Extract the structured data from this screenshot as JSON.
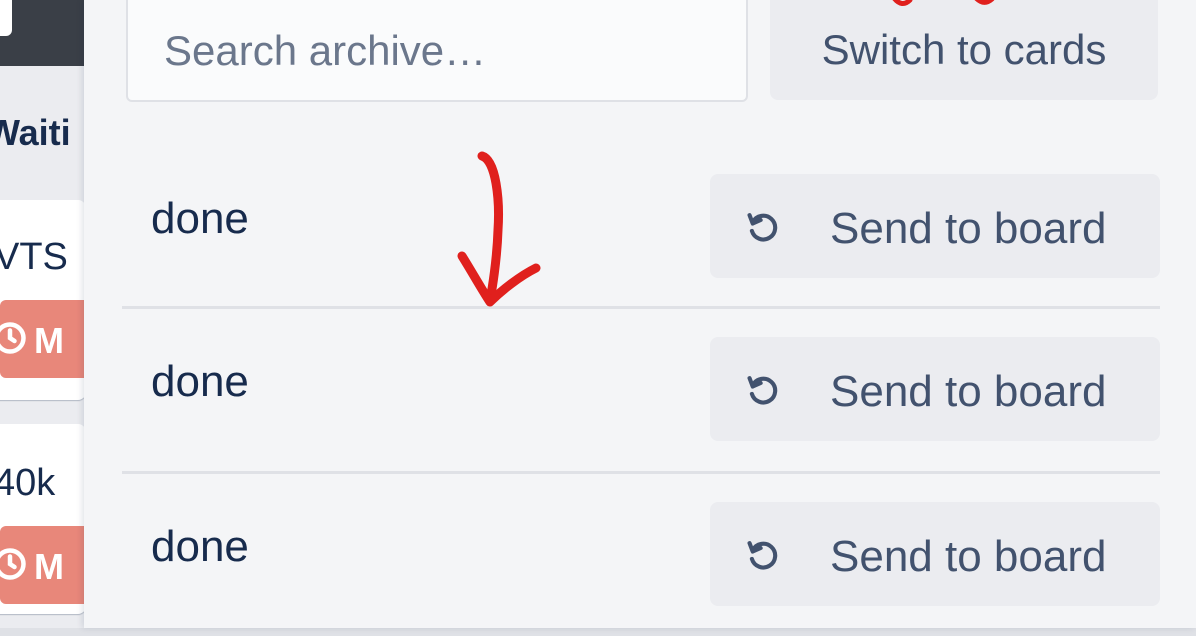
{
  "board_strip": {
    "list_title": "Waiti",
    "cards": [
      {
        "title": "VTS",
        "due_badge": "M"
      },
      {
        "title": "40k",
        "due_badge": "M"
      }
    ]
  },
  "archive": {
    "search": {
      "placeholder": "Search archive…",
      "value": ""
    },
    "switch_button_label": "Switch to cards",
    "items": [
      {
        "title": "done",
        "action_label": "Send to board"
      },
      {
        "title": "done",
        "action_label": "Send to board"
      },
      {
        "title": "done",
        "action_label": "Send to board"
      }
    ]
  },
  "icons": {
    "restore": "restore-icon",
    "clock": "clock-icon"
  },
  "colors": {
    "annotation": "#e0201d",
    "due_badge": "#e8877a",
    "button_bg": "#ebecf0",
    "panel_bg": "#f4f5f7"
  }
}
